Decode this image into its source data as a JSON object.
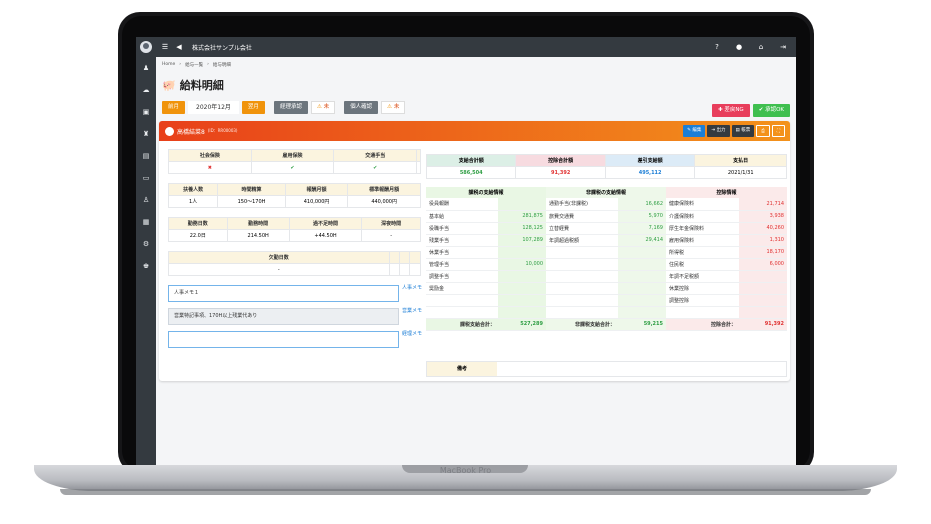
{
  "device": {
    "brand": "MacBook Pro"
  },
  "topbar": {
    "company": "株式会社サンプル会社"
  },
  "breadcrumb": [
    "Home",
    "給与一覧",
    "給与明細"
  ],
  "page": {
    "title": "給料明細"
  },
  "toolbar": {
    "prev": "前月",
    "month": "2020年12月",
    "next": "翌月",
    "keiri_label": "経理承認",
    "keiri_status": "未",
    "kojin_label": "個人確認",
    "kojin_status": "未",
    "ng_button": "差戻NG",
    "ok_button": "承認OK"
  },
  "employee": {
    "name": "高橋結菜8",
    "id": "(ID：RR00003)"
  },
  "card_buttons": {
    "edit": "編集",
    "output": "出力",
    "print": "帳票"
  },
  "insurance": {
    "headers": [
      "社会保険",
      "雇用保険",
      "交通手当"
    ],
    "values": [
      "✖",
      "✔",
      "✔"
    ]
  },
  "work1": {
    "headers": [
      "扶養人数",
      "時間精算",
      "報酬月額",
      "標準報酬月額"
    ],
    "values": [
      "1人",
      "150〜170H",
      "410,000円",
      "440,000円"
    ]
  },
  "work2": {
    "headers": [
      "勤務日数",
      "勤務時間",
      "過不足時間",
      "深夜時間"
    ],
    "values": [
      "22.0日",
      "214.50H",
      "+44.50H",
      "-"
    ]
  },
  "work3": {
    "header": "欠勤日数",
    "value": "-"
  },
  "memos": [
    {
      "text": "人事メモ１",
      "label": "人事メモ"
    },
    {
      "text": "営業特記事項、170H以上残業代あり",
      "label": "営業メモ"
    },
    {
      "text": "",
      "label": "経理メモ"
    }
  ],
  "summary": {
    "headers": [
      "支給合計額",
      "控除合計額",
      "差引支給額",
      "支払日"
    ],
    "values": [
      "586,504",
      "91,392",
      "495,112",
      "2021/1/31"
    ]
  },
  "details": {
    "headers": [
      "課税の支給情報",
      "非課税の支給情報",
      "控除情報"
    ],
    "rows": [
      [
        "役員報酬",
        "",
        "通勤手当(非課税)",
        "16,662",
        "健康保険料",
        "21,714"
      ],
      [
        "基本給",
        "281,875",
        "旅費交通費",
        "5,970",
        "介護保険料",
        "3,938"
      ],
      [
        "役職手当",
        "128,125",
        "立替経費",
        "7,169",
        "厚生年金保険料",
        "40,260"
      ],
      [
        "残業手当",
        "107,289",
        "年調超過税額",
        "29,414",
        "雇用保険料",
        "1,310"
      ],
      [
        "休業手当",
        "",
        "",
        "",
        "所得税",
        "18,170"
      ],
      [
        "管理手当",
        "10,000",
        "",
        "",
        "住民税",
        "6,000"
      ],
      [
        "調整手当",
        "",
        "",
        "",
        "年調不足税額",
        ""
      ],
      [
        "奨励金",
        "",
        "",
        "",
        "休業控除",
        ""
      ],
      [
        "",
        "",
        "",
        "",
        "調整控除",
        ""
      ],
      [
        "",
        "",
        "",
        "",
        "",
        ""
      ]
    ],
    "totals": [
      "課税支給合計：",
      "527,289",
      "非課税支給合計：",
      "59,215",
      "控除合計：",
      "91,392"
    ]
  },
  "remarks": {
    "label": "備考"
  },
  "colors": {
    "accent_orange": "#f0930b",
    "header_red": "#e8401a",
    "sidebar": "#343a40"
  }
}
